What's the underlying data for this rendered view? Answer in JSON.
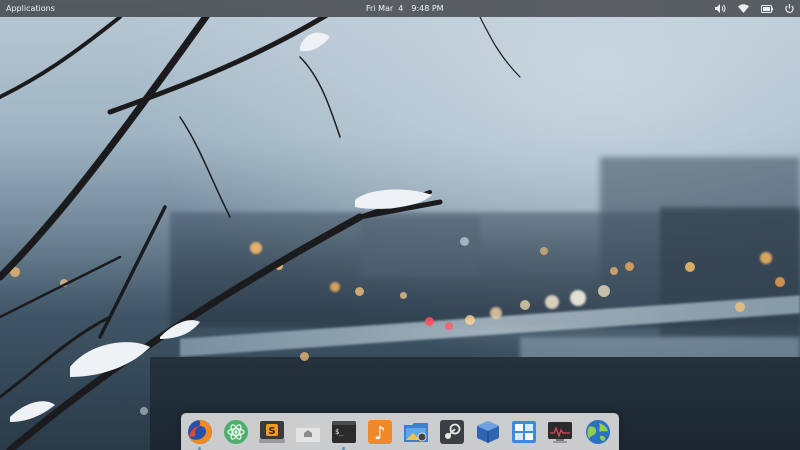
{
  "panel": {
    "applications_label": "Applications",
    "date": "Fri Mar  4",
    "time": "9:48 PM",
    "indicators": [
      "volume-icon",
      "wifi-icon",
      "battery-icon",
      "power-icon"
    ]
  },
  "dock": {
    "items": [
      {
        "name": "firefox",
        "icon": "firefox-icon"
      },
      {
        "name": "atom",
        "icon": "atom-icon"
      },
      {
        "name": "sublime-text",
        "icon": "sublime-text-icon",
        "glyph": "S"
      },
      {
        "name": "files",
        "icon": "home-folder-icon"
      },
      {
        "name": "terminal",
        "icon": "terminal-icon",
        "glyph": "$_"
      },
      {
        "name": "music",
        "icon": "music-icon",
        "glyph": "♪"
      },
      {
        "name": "photos",
        "icon": "photos-icon"
      },
      {
        "name": "steam",
        "icon": "steam-icon"
      },
      {
        "name": "virtualbox",
        "icon": "virtualbox-icon"
      },
      {
        "name": "workspaces",
        "icon": "workspaces-icon"
      },
      {
        "name": "system-monitor",
        "icon": "system-monitor-icon"
      },
      {
        "name": "web-browser",
        "icon": "globe-icon"
      }
    ]
  }
}
